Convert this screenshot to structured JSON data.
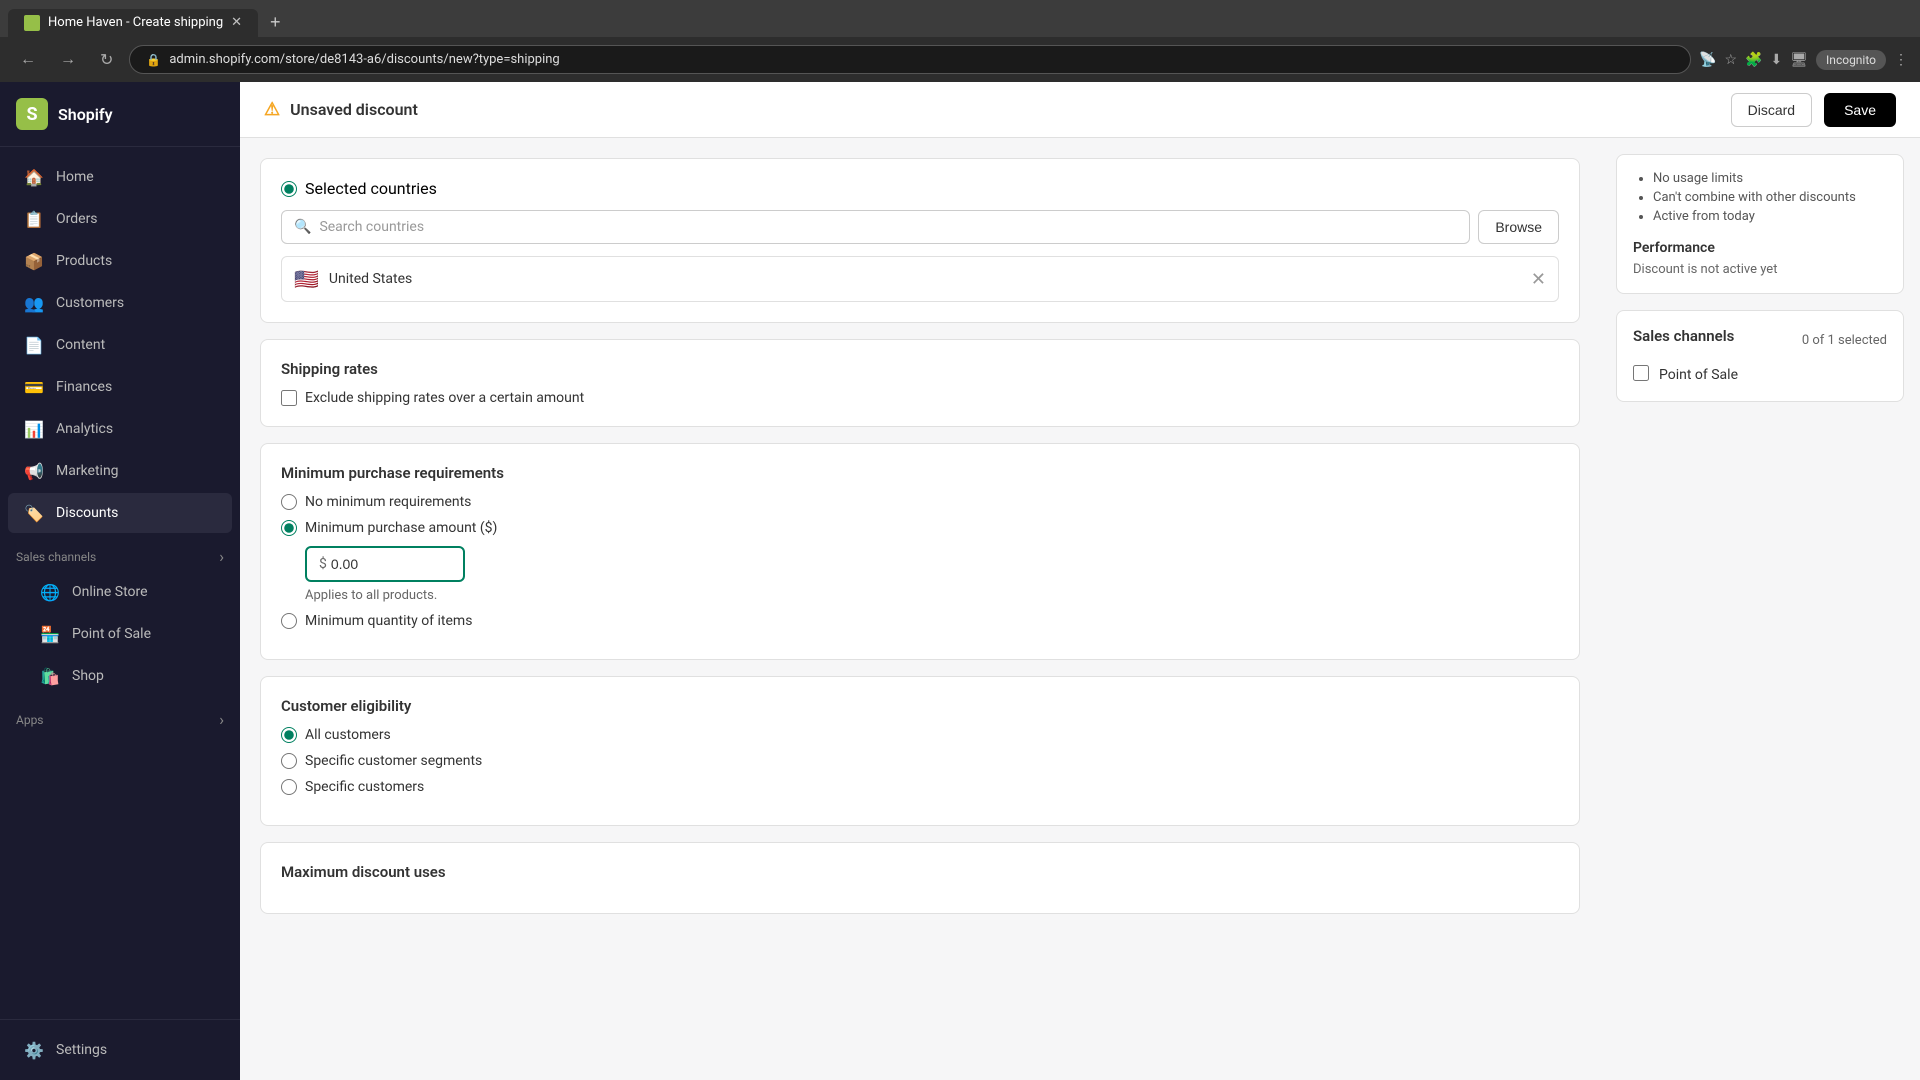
{
  "browser": {
    "tab_title": "Home Haven - Create shipping",
    "address_url": "admin.shopify.com/store/de8143-a6/discounts/new?type=shipping",
    "incognito_label": "Incognito"
  },
  "topbar": {
    "title": "Unsaved discount",
    "discard_label": "Discard",
    "save_label": "Save"
  },
  "sidebar": {
    "logo_name": "Shopify",
    "nav_items": [
      {
        "id": "home",
        "label": "Home",
        "icon": "🏠"
      },
      {
        "id": "orders",
        "label": "Orders",
        "icon": "📋"
      },
      {
        "id": "products",
        "label": "Products",
        "icon": "📦"
      },
      {
        "id": "customers",
        "label": "Customers",
        "icon": "👥"
      },
      {
        "id": "content",
        "label": "Content",
        "icon": "📄"
      },
      {
        "id": "finances",
        "label": "Finances",
        "icon": "💳"
      },
      {
        "id": "analytics",
        "label": "Analytics",
        "icon": "📊"
      },
      {
        "id": "marketing",
        "label": "Marketing",
        "icon": "📢"
      },
      {
        "id": "discounts",
        "label": "Discounts",
        "icon": "🏷️"
      }
    ],
    "sales_channels_label": "Sales channels",
    "sales_channels_items": [
      {
        "id": "online-store",
        "label": "Online Store",
        "icon": "🌐"
      },
      {
        "id": "point-of-sale",
        "label": "Point of Sale",
        "icon": "🏪"
      },
      {
        "id": "shop",
        "label": "Shop",
        "icon": "🛍️"
      }
    ],
    "apps_label": "Apps",
    "settings_label": "Settings"
  },
  "main": {
    "countries_section": {
      "selected_countries_label": "Selected countries",
      "search_placeholder": "Search countries",
      "browse_label": "Browse",
      "country_name": "United States",
      "country_flag": "🇺🇸"
    },
    "shipping_rates": {
      "title": "Shipping rates",
      "exclude_label": "Exclude shipping rates over a certain amount"
    },
    "minimum_purchase": {
      "title": "Minimum purchase requirements",
      "no_minimum_label": "No minimum requirements",
      "minimum_amount_label": "Minimum purchase amount ($)",
      "minimum_quantity_label": "Minimum quantity of items",
      "amount_value": "0.00",
      "currency_sign": "$",
      "applies_text": "Applies to all products."
    },
    "customer_eligibility": {
      "title": "Customer eligibility",
      "all_customers_label": "All customers",
      "specific_segments_label": "Specific customer segments",
      "specific_customers_label": "Specific customers"
    },
    "max_discount_uses": {
      "title": "Maximum discount uses"
    }
  },
  "right_panel": {
    "summary": {
      "no_usage_limits": "No usage limits",
      "cant_combine": "Can't combine with other discounts",
      "active_from": "Active from today"
    },
    "performance": {
      "title": "Performance",
      "text": "Discount is not active yet"
    },
    "sales_channels": {
      "title": "Sales channels",
      "count_text": "0 of 1 selected",
      "point_of_sale_label": "Point of Sale"
    }
  }
}
